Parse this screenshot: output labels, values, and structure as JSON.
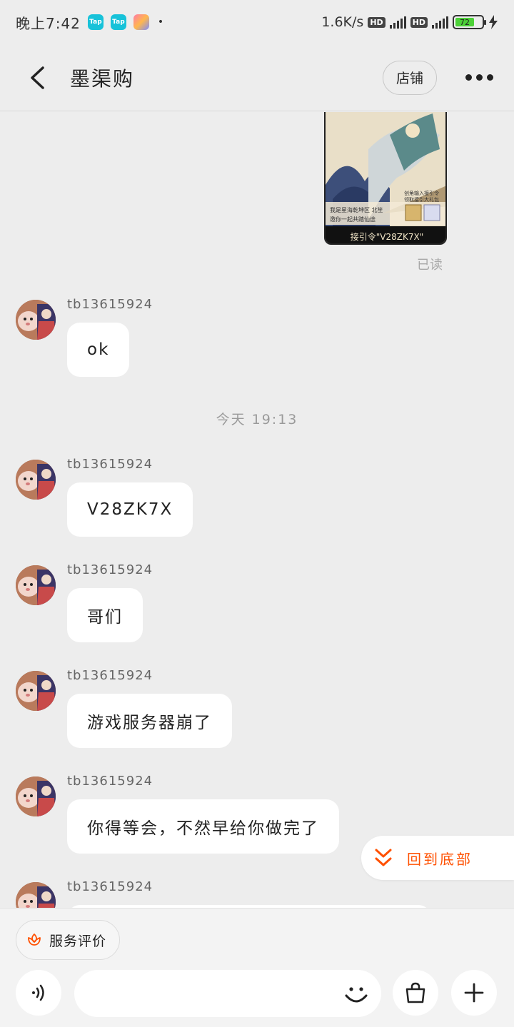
{
  "status_bar": {
    "time": "晚上7:42",
    "app1": "Tap",
    "app2": "Tap",
    "dot": "•",
    "net_speed": "1.6K/s",
    "hd1": "HD",
    "hd2": "HD",
    "battery": "72"
  },
  "nav": {
    "title": "墨渠购",
    "store_label": "店铺"
  },
  "chat": {
    "image_message": {
      "caption_line1": "我是星海乾坤区 北笙",
      "caption_line2": "邀你一起共踏仙途",
      "side_line1": "创角输入接引令",
      "side_line2": "领取接引大礼包",
      "code_banner": "接引令\"V28ZK7X\""
    },
    "read_status": "已读",
    "time_divider": "今天  19:13",
    "messages": [
      {
        "sender": "tb13615924",
        "text": "ok"
      },
      {
        "sender": "tb13615924",
        "text": "V28ZK7X"
      },
      {
        "sender": "tb13615924",
        "text": "哥们"
      },
      {
        "sender": "tb13615924",
        "text": "游戏服务器崩了"
      },
      {
        "sender": "tb13615924",
        "text": "你得等会，不然早给你做完了"
      },
      {
        "sender": "tb13615924",
        "text": ""
      }
    ]
  },
  "scroll_to_bottom": {
    "label": "回到底部"
  },
  "bottom": {
    "quick_action": "服务评价",
    "input_placeholder": ""
  },
  "colors": {
    "accent": "#ff5000",
    "background": "#ededed",
    "bubble": "#ffffff"
  },
  "icons": [
    "back-arrow-icon",
    "more-dots-icon",
    "voice-icon",
    "emoji-icon",
    "shopping-bag-icon",
    "plus-icon",
    "service-rating-icon",
    "double-chevron-down-icon"
  ]
}
